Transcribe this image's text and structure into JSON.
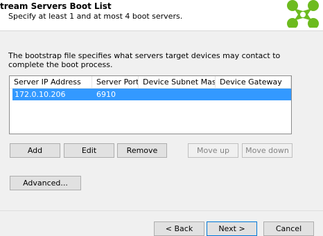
{
  "header": {
    "title": "tream Servers Boot List",
    "subtitle": "Specify at least 1 and at most 4 boot servers."
  },
  "logo": {
    "icon": "citrix-logo-icon",
    "color": "#6dbb1f"
  },
  "description": "The bootstrap file specifies what servers target devices may contact to complete the boot process.",
  "list": {
    "columns": [
      "Server IP Address",
      "Server Port",
      "Device Subnet Mask",
      "Device Gateway"
    ],
    "rows": [
      {
        "ip": "172.0.10.206",
        "port": "6910",
        "mask": "",
        "gateway": ""
      }
    ],
    "selection_color": "#3399ff"
  },
  "buttons": {
    "add": "Add",
    "edit": "Edit",
    "remove": "Remove",
    "move_up": "Move up",
    "move_down": "Move down",
    "advanced": "Advanced..."
  },
  "nav": {
    "back": "< Back",
    "next": "Next >",
    "cancel": "Cancel"
  }
}
